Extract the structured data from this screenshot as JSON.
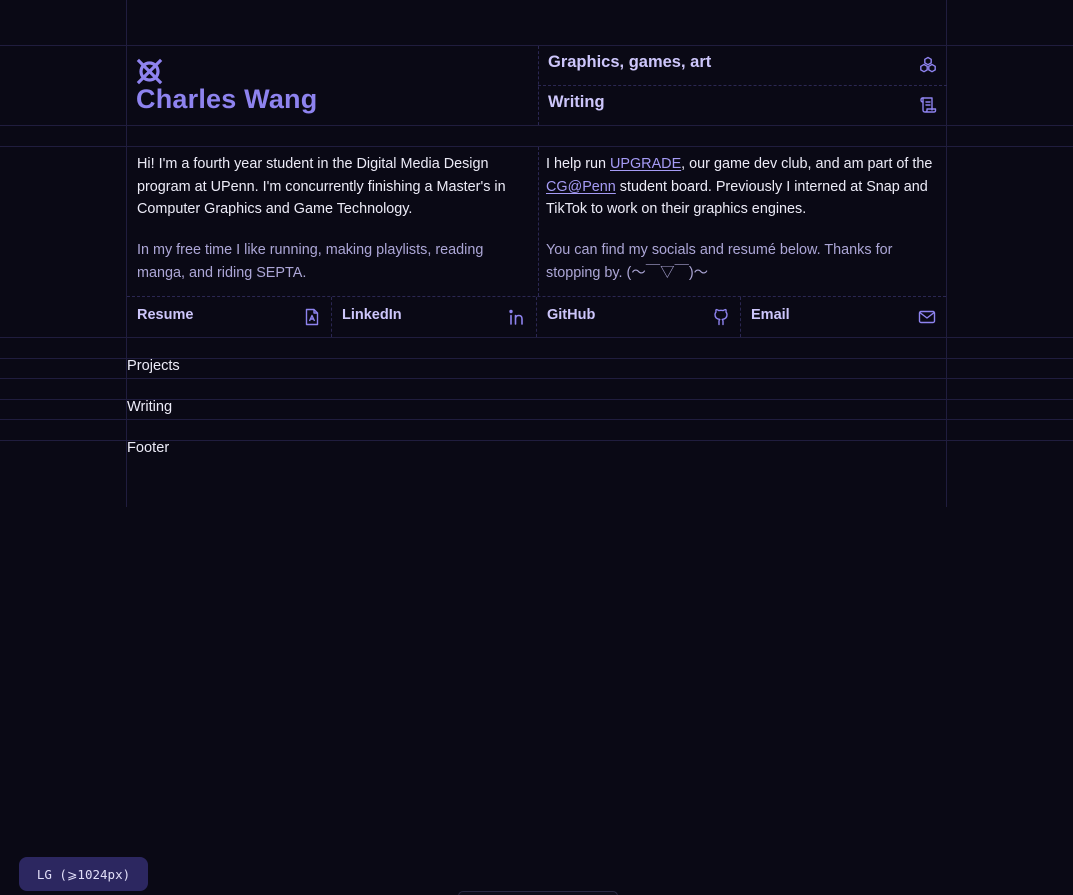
{
  "header": {
    "name": "Charles Wang",
    "logo_icon": "interlocked-x-logo-icon",
    "nav": [
      {
        "label": "Graphics, games, art",
        "icon": "cubes-icon"
      },
      {
        "label": "Writing",
        "icon": "scroll-icon"
      }
    ]
  },
  "intro": {
    "left_p1": "Hi! I'm a fourth year student in the Digital Media Design program at UPenn. I'm concurrently finishing a Master's in Computer Graphics and Game Technology.",
    "left_p2": "In my free time I like running, making playlists, reading manga, and riding SEPTA.",
    "right_p1_a": "I help run ",
    "right_p1_link1": "UPGRADE",
    "right_p1_b": ", our game dev club, and am part of the ",
    "right_p1_link2": "CG@Penn",
    "right_p1_c": " student board. Previously I interned at Snap and TikTok to work on their graphics engines.",
    "right_p2": "You can find my socials and resumé below. Thanks for stopping by. (〜￣▽￣)〜"
  },
  "links": [
    {
      "label": "Resume",
      "icon": "file-document-icon"
    },
    {
      "label": "LinkedIn",
      "icon": "linkedin-icon"
    },
    {
      "label": "GitHub",
      "icon": "github-icon"
    },
    {
      "label": "Email",
      "icon": "mail-icon"
    }
  ],
  "sections": {
    "projects": "Projects",
    "writing": "Writing",
    "footer": "Footer"
  },
  "breakpoint_badge": "LG (⩾1024px)",
  "colors": {
    "background": "#0a0915",
    "accent": "#8e83ef",
    "nav_text": "#cdc6fb",
    "grid_line": "#201d3e"
  }
}
